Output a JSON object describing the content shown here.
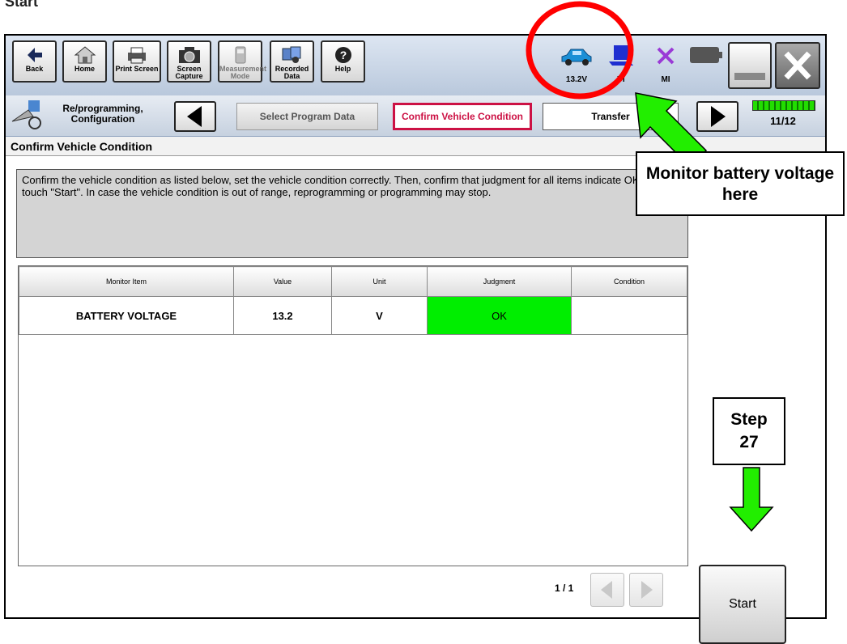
{
  "page_heading": "Start",
  "toolbar": {
    "buttons": [
      {
        "label": "Back",
        "icon": "back-arrow-icon"
      },
      {
        "label": "Home",
        "icon": "home-icon"
      },
      {
        "label": "Print Screen",
        "icon": "printer-icon"
      },
      {
        "label": "Screen Capture",
        "icon": "camera-icon"
      },
      {
        "label": "Measurement Mode",
        "icon": "meter-icon"
      },
      {
        "label": "Recorded Data",
        "icon": "recorded-data-icon"
      },
      {
        "label": "Help",
        "icon": "help-icon"
      }
    ],
    "status": {
      "voltage": "13.2V",
      "vi": "VI",
      "mi": "MI"
    }
  },
  "breadcrumb": {
    "section": "Re/programming, Configuration",
    "prev_step": "Select Program Data",
    "current_step": "Confirm Vehicle Condition",
    "next_step": "Transfer",
    "progress": "11/12"
  },
  "screen_title": "Confirm Vehicle Condition",
  "instructions": "Confirm the vehicle condition as listed below, set the vehicle condition correctly. Then, confirm that judgment for all items indicate OK, and touch \"Start\". In case the vehicle condition is out of range, reprogramming or programming may stop.",
  "table": {
    "headers": [
      "Monitor Item",
      "Value",
      "Unit",
      "Judgment",
      "Condition"
    ],
    "rows": [
      {
        "item": "BATTERY VOLTAGE",
        "value": "13.2",
        "unit": "V",
        "judgment": "OK",
        "condition": ""
      }
    ]
  },
  "pager": {
    "page": "1 / 1"
  },
  "start_label": "Start",
  "callouts": {
    "battery": "Monitor battery voltage here",
    "step": "Step 27"
  },
  "colors": {
    "ok_green": "#00ee00",
    "highlight_red": "#ff0000",
    "arrow_green": "#22ee00",
    "step_crimson": "#cc1144"
  }
}
